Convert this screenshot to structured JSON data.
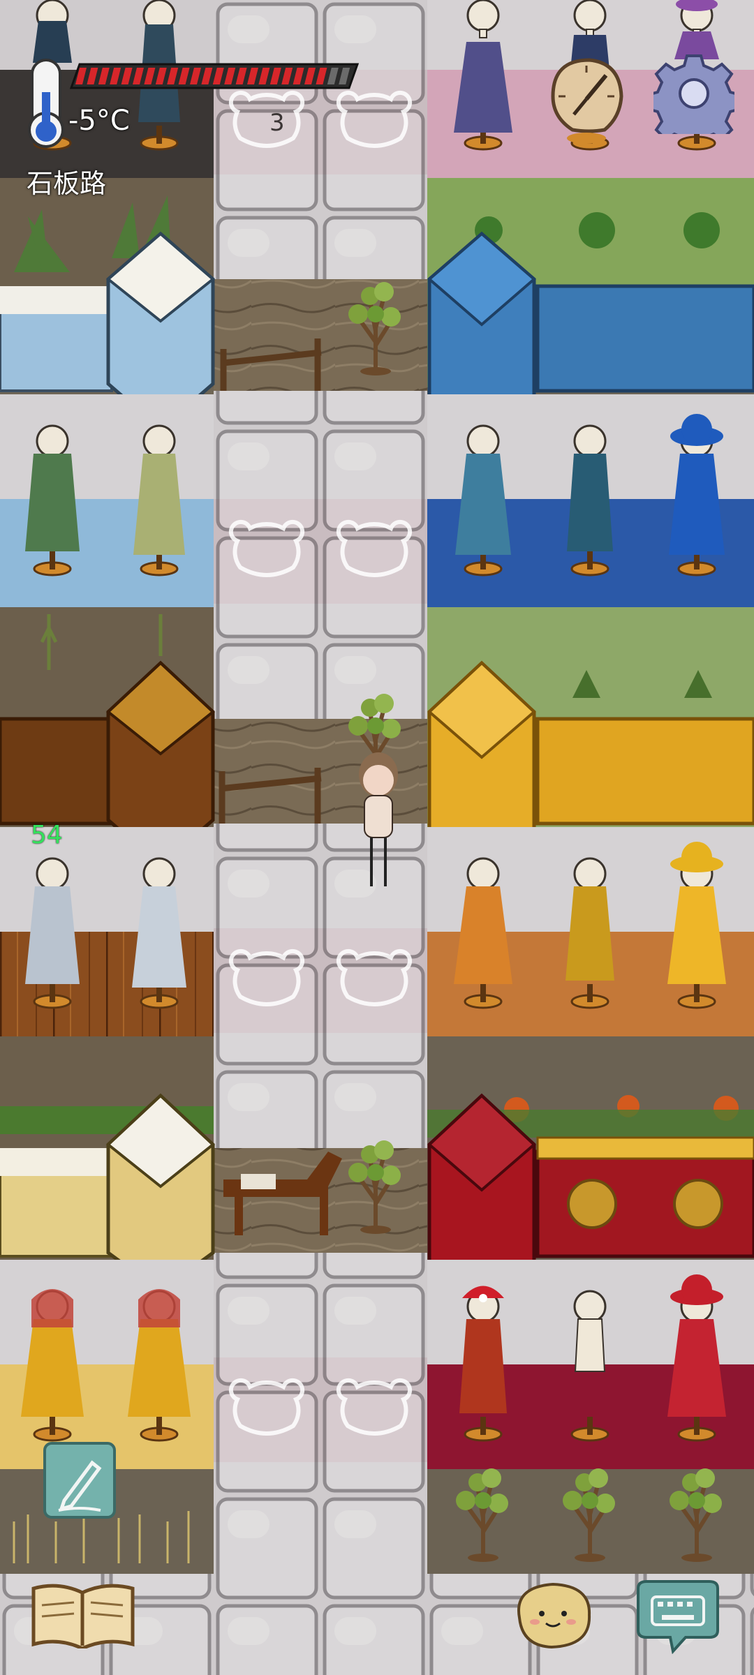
{
  "hud": {
    "temperature": "-5°C",
    "location": "石板路",
    "health_fraction": 0.93,
    "counter": "3",
    "player_number": "54"
  },
  "icons": {
    "thermometer": "thermometer-icon",
    "clock": "clock-icon",
    "settings": "gear-icon",
    "edit": "pencil-icon",
    "book": "book-icon",
    "emote": "smiley-potato-icon",
    "keyboard": "keyboard-chat-icon"
  },
  "colors": {
    "health": "#d7262a",
    "stone": "#c8c4c6",
    "blue_wall": "#3b79b3",
    "yellow_wall": "#e0a521",
    "red_wall": "#a11720",
    "player_number": "#34e15c"
  }
}
